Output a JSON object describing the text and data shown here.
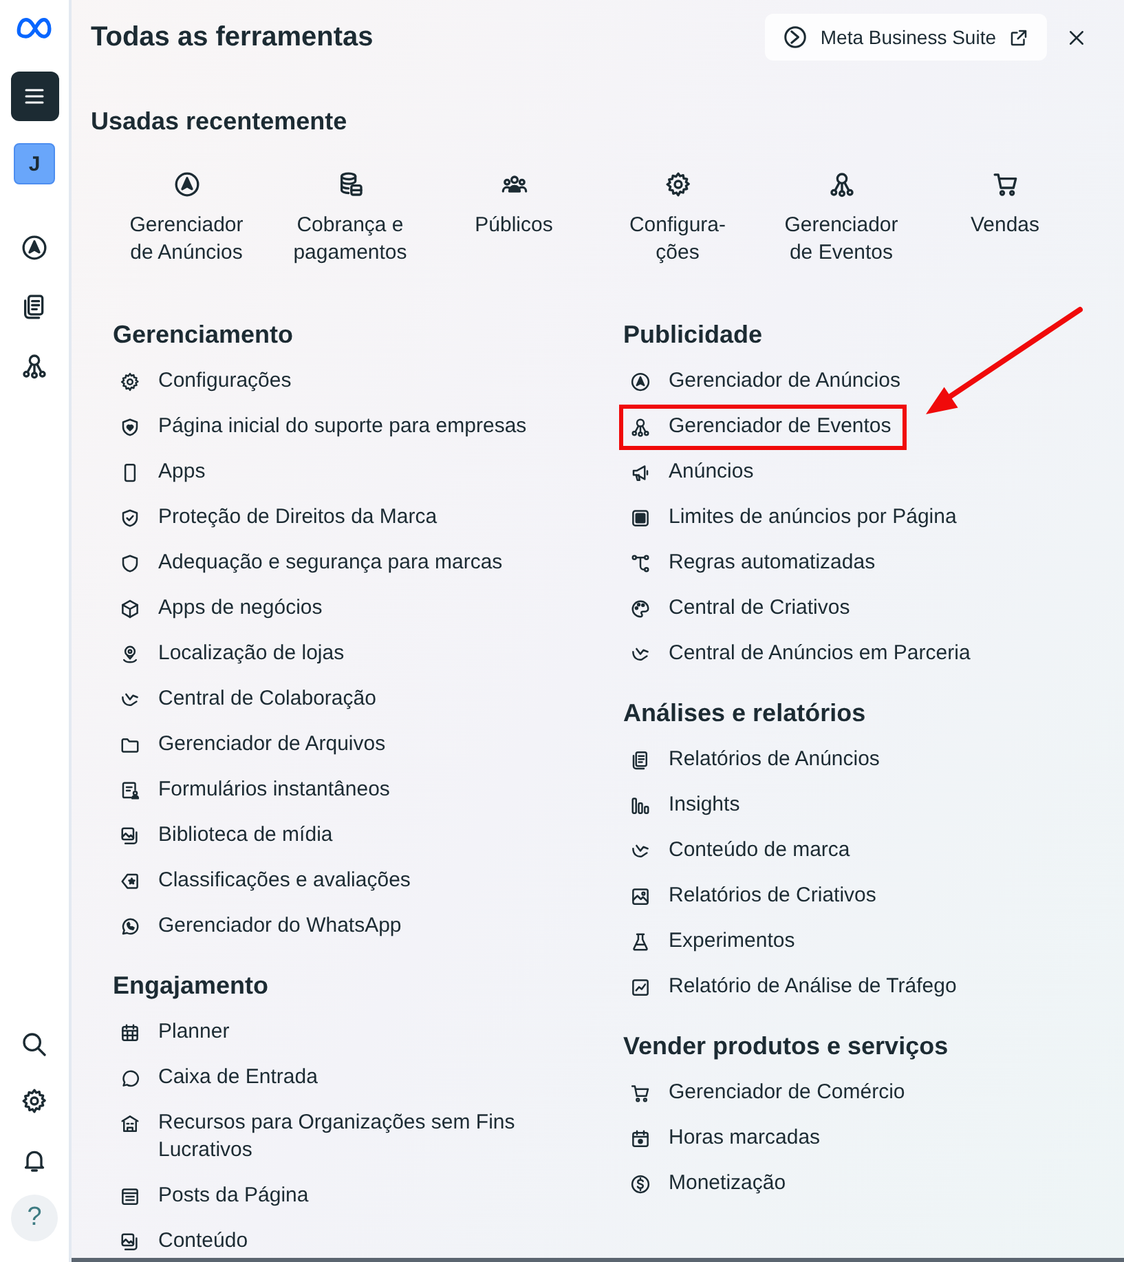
{
  "sidebar": {
    "avatar": "J",
    "help": "?"
  },
  "header": {
    "title": "Todas as ferramentas",
    "suite_button": "Meta Business Suite"
  },
  "recent": {
    "title": "Usadas recentemente",
    "items": [
      "Gerenciador de Anúncios",
      "Cobrança e pagamentos",
      "Públicos",
      "Configura-ções",
      "Gerenciador de Eventos",
      "Vendas"
    ]
  },
  "columns": [
    {
      "sections": [
        {
          "title": "Gerenciamento",
          "items": [
            {
              "label": "Configurações",
              "highlighted": false
            },
            {
              "label": "Página inicial do suporte para empresas",
              "highlighted": false
            },
            {
              "label": "Apps",
              "highlighted": false
            },
            {
              "label": "Proteção de Direitos da Marca",
              "highlighted": false
            },
            {
              "label": "Adequação e segurança para marcas",
              "highlighted": false
            },
            {
              "label": "Apps de negócios",
              "highlighted": false
            },
            {
              "label": "Localização de lojas",
              "highlighted": false
            },
            {
              "label": "Central de Colaboração",
              "highlighted": false
            },
            {
              "label": "Gerenciador de Arquivos",
              "highlighted": false
            },
            {
              "label": "Formulários instantâneos",
              "highlighted": false
            },
            {
              "label": "Biblioteca de mídia",
              "highlighted": false
            },
            {
              "label": "Classificações e avaliações",
              "highlighted": false
            },
            {
              "label": "Gerenciador do WhatsApp",
              "highlighted": false
            }
          ]
        },
        {
          "title": "Engajamento",
          "items": [
            {
              "label": "Planner",
              "highlighted": false
            },
            {
              "label": "Caixa de Entrada",
              "highlighted": false
            },
            {
              "label": "Recursos para Organizações sem Fins Lucrativos",
              "highlighted": false
            },
            {
              "label": "Posts da Página",
              "highlighted": false
            },
            {
              "label": "Conteúdo",
              "highlighted": false
            }
          ]
        }
      ]
    },
    {
      "sections": [
        {
          "title": "Publicidade",
          "items": [
            {
              "label": "Gerenciador de Anúncios",
              "highlighted": false
            },
            {
              "label": "Gerenciador de Eventos",
              "highlighted": true
            },
            {
              "label": "Anúncios",
              "highlighted": false
            },
            {
              "label": "Limites de anúncios por Página",
              "highlighted": false
            },
            {
              "label": "Regras automatizadas",
              "highlighted": false
            },
            {
              "label": "Central de Criativos",
              "highlighted": false
            },
            {
              "label": "Central de Anúncios em Parceria",
              "highlighted": false
            }
          ]
        },
        {
          "title": "Análises e relatórios",
          "items": [
            {
              "label": "Relatórios de Anúncios",
              "highlighted": false
            },
            {
              "label": "Insights",
              "highlighted": false
            },
            {
              "label": "Conteúdo de marca",
              "highlighted": false
            },
            {
              "label": "Relatórios de Criativos",
              "highlighted": false
            },
            {
              "label": "Experimentos",
              "highlighted": false
            },
            {
              "label": "Relatório de Análise de Tráfego",
              "highlighted": false
            }
          ]
        },
        {
          "title": "Vender produtos e serviços",
          "items": [
            {
              "label": "Gerenciador de Comércio",
              "highlighted": false
            },
            {
              "label": "Horas marcadas",
              "highlighted": false
            },
            {
              "label": "Monetização",
              "highlighted": false
            }
          ]
        }
      ]
    }
  ]
}
